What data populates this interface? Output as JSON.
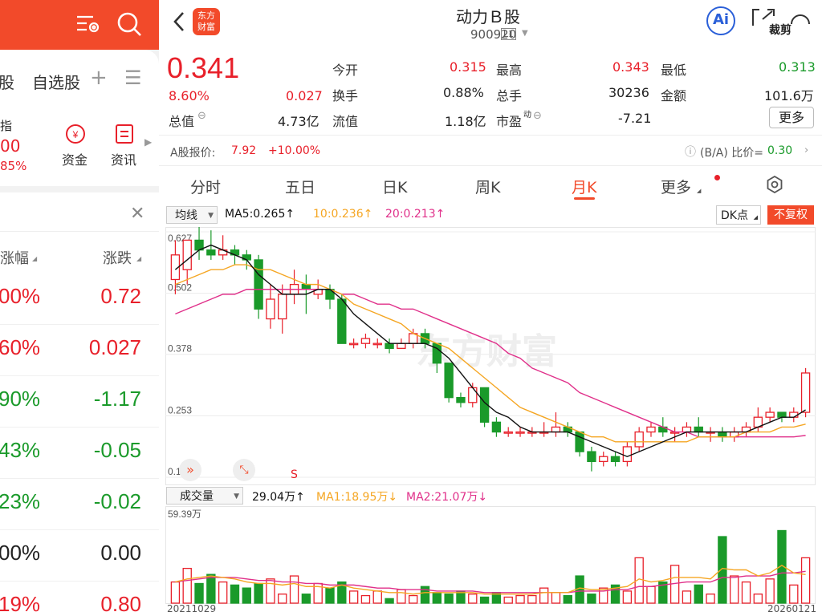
{
  "left": {
    "tabs": {
      "partial_stock": "股",
      "watchlist": "自选股"
    },
    "index": {
      "name": "指",
      "value": "00",
      "change": "85%"
    },
    "shortcuts": {
      "funds": "资金",
      "news": "资讯"
    },
    "columns": {
      "change_pct": "涨幅",
      "change_amt": "涨跌"
    },
    "rows": [
      {
        "pct": "00%",
        "amt": "0.72",
        "color": "red"
      },
      {
        "pct": "60%",
        "amt": "0.027",
        "color": "red"
      },
      {
        "pct": "90%",
        "amt": "-1.17",
        "color": "green"
      },
      {
        "pct": "43%",
        "amt": "-0.05",
        "color": "green"
      },
      {
        "pct": "23%",
        "amt": "-0.02",
        "color": "green"
      },
      {
        "pct": "00%",
        "amt": "0.00",
        "color": "dark"
      },
      {
        "pct": "19%",
        "amt": "0.80",
        "color": "red"
      }
    ]
  },
  "header": {
    "logo_line1": "东方",
    "logo_line2": "财富",
    "title": "动力Ｂ股",
    "code": "900920",
    "level": "L1",
    "ai_label": "Ai",
    "crop_label": "裁剪"
  },
  "quote": {
    "price": "0.341",
    "change_pct": "8.60%",
    "change_amt": "0.027",
    "total_cap_label": "总值",
    "total_cap": "4.73亿",
    "open_label": "今开",
    "open": "0.315",
    "turnover_label": "换手",
    "turnover": "0.88%",
    "float_label": "流值",
    "float_cap": "1.18亿",
    "high_label": "最高",
    "high": "0.343",
    "volume_label": "总手",
    "volume": "30236",
    "pe_label": "市盈",
    "pe_sup": "动",
    "pe": "-7.21",
    "low_label": "最低",
    "low": "0.313",
    "amount_label": "金额",
    "amount": "101.6万",
    "more_label": "更多"
  },
  "ashare": {
    "label": "A股报价:",
    "price": "7.92",
    "change": "+10.00%",
    "ratio_label": "(B/A) 比价=",
    "ratio": "0.30"
  },
  "tabs": [
    "分时",
    "五日",
    "日K",
    "周K",
    "月K",
    "更多"
  ],
  "active_tab": "月K",
  "indicator_bar": {
    "selector": "均线",
    "ma5": "MA5:0.265↑",
    "ma10": "10:0.236↑",
    "ma20": "20:0.213↑",
    "dk": "DK点",
    "adjust": "不复权"
  },
  "volume_bar": {
    "selector": "成交量",
    "vol": "29.04万↑",
    "ma1": "MA1:18.95万↓",
    "ma2": "MA2:21.07万↓"
  },
  "watermark": "东方财富",
  "colors": {
    "up": "#e8202a",
    "down": "#1a9a2a",
    "ma5": "#111111",
    "ma10": "#f5a623",
    "ma20": "#e0308a",
    "accent": "#f24a2a"
  },
  "chart_data": {
    "type": "candlestick",
    "y_ticks": [
      "0.627",
      "0.502",
      "0.378",
      "0.253",
      "0.128"
    ],
    "ylim": [
      0.128,
      0.627
    ],
    "start_date": "20211029",
    "end_date": "20260121",
    "volume_max_label": "59.39万",
    "volume_max": 59.39,
    "signal_label": "S",
    "candles": [
      [
        0.53,
        0.58,
        0.61,
        0.5
      ],
      [
        0.55,
        0.61,
        0.61,
        0.52
      ],
      [
        0.61,
        0.59,
        0.64,
        0.57
      ],
      [
        0.59,
        0.58,
        0.63,
        0.57
      ],
      [
        0.58,
        0.59,
        0.62,
        0.57
      ],
      [
        0.59,
        0.58,
        0.6,
        0.56
      ],
      [
        0.58,
        0.57,
        0.59,
        0.55
      ],
      [
        0.57,
        0.47,
        0.58,
        0.45
      ],
      [
        0.45,
        0.49,
        0.52,
        0.43
      ],
      [
        0.45,
        0.5,
        0.52,
        0.42
      ],
      [
        0.5,
        0.52,
        0.55,
        0.48
      ],
      [
        0.52,
        0.51,
        0.54,
        0.46
      ],
      [
        0.5,
        0.51,
        0.53,
        0.49
      ],
      [
        0.51,
        0.49,
        0.52,
        0.47
      ],
      [
        0.49,
        0.4,
        0.5,
        0.4
      ],
      [
        0.4,
        0.4,
        0.41,
        0.39
      ],
      [
        0.4,
        0.41,
        0.42,
        0.39
      ],
      [
        0.4,
        0.4,
        0.41,
        0.39
      ],
      [
        0.4,
        0.39,
        0.41,
        0.38
      ],
      [
        0.39,
        0.4,
        0.41,
        0.39
      ],
      [
        0.4,
        0.42,
        0.43,
        0.39
      ],
      [
        0.42,
        0.4,
        0.43,
        0.39
      ],
      [
        0.4,
        0.36,
        0.4,
        0.34
      ],
      [
        0.36,
        0.29,
        0.36,
        0.28
      ],
      [
        0.29,
        0.28,
        0.3,
        0.27
      ],
      [
        0.28,
        0.31,
        0.32,
        0.27
      ],
      [
        0.31,
        0.24,
        0.31,
        0.23
      ],
      [
        0.24,
        0.22,
        0.25,
        0.21
      ],
      [
        0.22,
        0.22,
        0.23,
        0.21
      ],
      [
        0.22,
        0.22,
        0.23,
        0.21
      ],
      [
        0.22,
        0.22,
        0.23,
        0.21
      ],
      [
        0.22,
        0.22,
        0.24,
        0.21
      ],
      [
        0.22,
        0.23,
        0.26,
        0.21
      ],
      [
        0.23,
        0.22,
        0.24,
        0.21
      ],
      [
        0.22,
        0.18,
        0.22,
        0.17
      ],
      [
        0.18,
        0.16,
        0.19,
        0.14
      ],
      [
        0.16,
        0.17,
        0.18,
        0.15
      ],
      [
        0.17,
        0.16,
        0.18,
        0.15
      ],
      [
        0.16,
        0.19,
        0.2,
        0.15
      ],
      [
        0.19,
        0.22,
        0.23,
        0.18
      ],
      [
        0.22,
        0.23,
        0.24,
        0.21
      ],
      [
        0.23,
        0.22,
        0.25,
        0.21
      ],
      [
        0.22,
        0.22,
        0.23,
        0.2
      ],
      [
        0.22,
        0.23,
        0.24,
        0.21
      ],
      [
        0.23,
        0.22,
        0.25,
        0.21
      ],
      [
        0.22,
        0.22,
        0.23,
        0.2
      ],
      [
        0.22,
        0.21,
        0.23,
        0.2
      ],
      [
        0.21,
        0.22,
        0.23,
        0.2
      ],
      [
        0.22,
        0.23,
        0.24,
        0.21
      ],
      [
        0.23,
        0.25,
        0.27,
        0.22
      ],
      [
        0.25,
        0.26,
        0.27,
        0.24
      ],
      [
        0.26,
        0.25,
        0.26,
        0.24
      ],
      [
        0.25,
        0.26,
        0.27,
        0.24
      ],
      [
        0.26,
        0.34,
        0.35,
        0.25
      ]
    ],
    "ma5": [
      0.55,
      0.57,
      0.59,
      0.6,
      0.59,
      0.58,
      0.57,
      0.54,
      0.52,
      0.5,
      0.5,
      0.5,
      0.51,
      0.51,
      0.49,
      0.46,
      0.44,
      0.42,
      0.4,
      0.4,
      0.4,
      0.4,
      0.39,
      0.37,
      0.34,
      0.31,
      0.28,
      0.26,
      0.25,
      0.23,
      0.22,
      0.22,
      0.22,
      0.22,
      0.21,
      0.2,
      0.19,
      0.18,
      0.17,
      0.18,
      0.19,
      0.2,
      0.21,
      0.22,
      0.22,
      0.22,
      0.22,
      0.22,
      0.22,
      0.23,
      0.24,
      0.25,
      0.25,
      0.265
    ],
    "ma10": [
      0.52,
      0.53,
      0.54,
      0.55,
      0.55,
      0.56,
      0.56,
      0.55,
      0.55,
      0.54,
      0.53,
      0.52,
      0.52,
      0.51,
      0.5,
      0.48,
      0.47,
      0.46,
      0.45,
      0.44,
      0.42,
      0.41,
      0.4,
      0.39,
      0.37,
      0.35,
      0.33,
      0.31,
      0.29,
      0.27,
      0.26,
      0.25,
      0.24,
      0.23,
      0.22,
      0.21,
      0.21,
      0.2,
      0.2,
      0.2,
      0.2,
      0.2,
      0.2,
      0.2,
      0.21,
      0.21,
      0.21,
      0.21,
      0.22,
      0.22,
      0.22,
      0.23,
      0.23,
      0.236
    ],
    "ma20": [
      0.46,
      0.47,
      0.48,
      0.49,
      0.5,
      0.5,
      0.51,
      0.51,
      0.51,
      0.51,
      0.51,
      0.51,
      0.51,
      0.51,
      0.5,
      0.5,
      0.49,
      0.48,
      0.48,
      0.47,
      0.47,
      0.46,
      0.45,
      0.44,
      0.43,
      0.42,
      0.41,
      0.4,
      0.38,
      0.37,
      0.35,
      0.34,
      0.33,
      0.32,
      0.3,
      0.29,
      0.28,
      0.27,
      0.26,
      0.25,
      0.24,
      0.23,
      0.22,
      0.22,
      0.21,
      0.21,
      0.21,
      0.21,
      0.21,
      0.21,
      0.21,
      0.21,
      0.21,
      0.213
    ],
    "volume": [
      14,
      23,
      13,
      19,
      14,
      12,
      10,
      13,
      16,
      6,
      18,
      6,
      13,
      10,
      14,
      8,
      5,
      8,
      3,
      9,
      5,
      11,
      7,
      6,
      8,
      6,
      4,
      7,
      4,
      5,
      5,
      10,
      7,
      5,
      18,
      6,
      10,
      12,
      8,
      30,
      11,
      14,
      25,
      8,
      12,
      6,
      44,
      18,
      14,
      6,
      16,
      48,
      12,
      30
    ],
    "vol_ma1": [
      14,
      16,
      17,
      18,
      17,
      16,
      14,
      13,
      13,
      12,
      13,
      11,
      11,
      10,
      12,
      10,
      9,
      8,
      7,
      7,
      6,
      7,
      7,
      7,
      7,
      7,
      6,
      6,
      6,
      6,
      6,
      7,
      7,
      7,
      10,
      9,
      9,
      10,
      11,
      16,
      14,
      15,
      17,
      17,
      17,
      16,
      23,
      22,
      22,
      18,
      20,
      25,
      20,
      18.95
    ],
    "vol_ma2": [
      14,
      15,
      16,
      17,
      17,
      17,
      16,
      15,
      15,
      14,
      14,
      13,
      13,
      12,
      12,
      12,
      11,
      10,
      10,
      9,
      9,
      9,
      8,
      8,
      8,
      8,
      7,
      7,
      7,
      7,
      7,
      7,
      7,
      7,
      8,
      8,
      8,
      9,
      9,
      11,
      11,
      12,
      13,
      14,
      14,
      14,
      17,
      17,
      18,
      18,
      18,
      20,
      20,
      21.07
    ]
  }
}
